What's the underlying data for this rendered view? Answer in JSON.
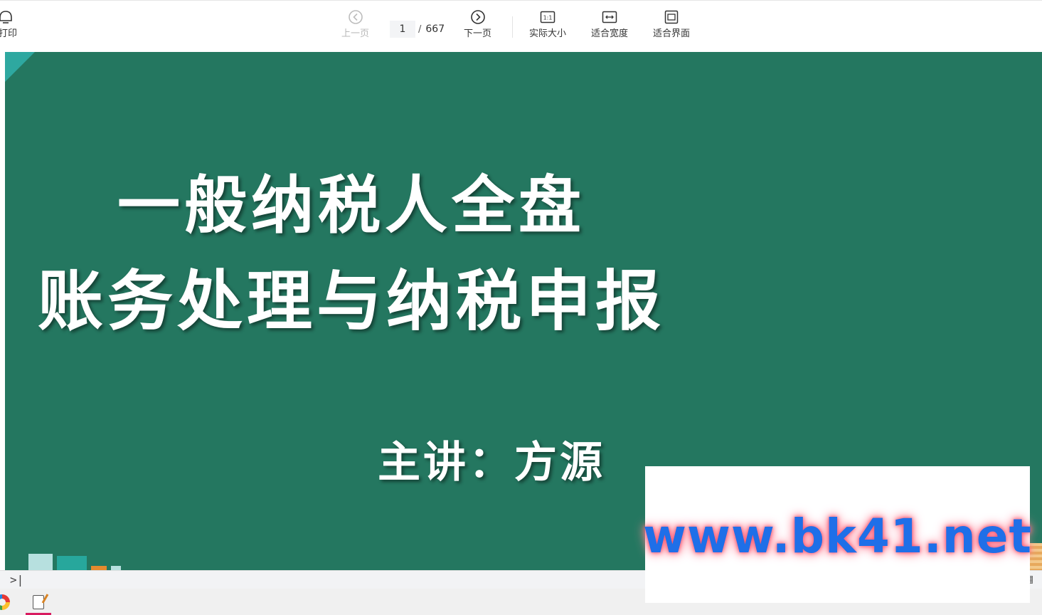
{
  "toolbar": {
    "print_label": "打印",
    "prev_label": "上一页",
    "next_label": "下一页",
    "actual_size_label": "实际大小",
    "fit_width_label": "适合宽度",
    "fit_page_label": "适合界面",
    "actual_size_glyph": "1:1"
  },
  "pager": {
    "current_page": "1",
    "separator": "/",
    "total_pages": "667"
  },
  "slide": {
    "title_line1": "一般纳税人全盘",
    "title_line2": "账务处理与纳税申报",
    "presenter": "主讲：方源",
    "background_color": "#247760"
  },
  "watermark": {
    "text": "www.bk41.net"
  },
  "bottom_bar": {
    "expand_glyph": ">|"
  }
}
